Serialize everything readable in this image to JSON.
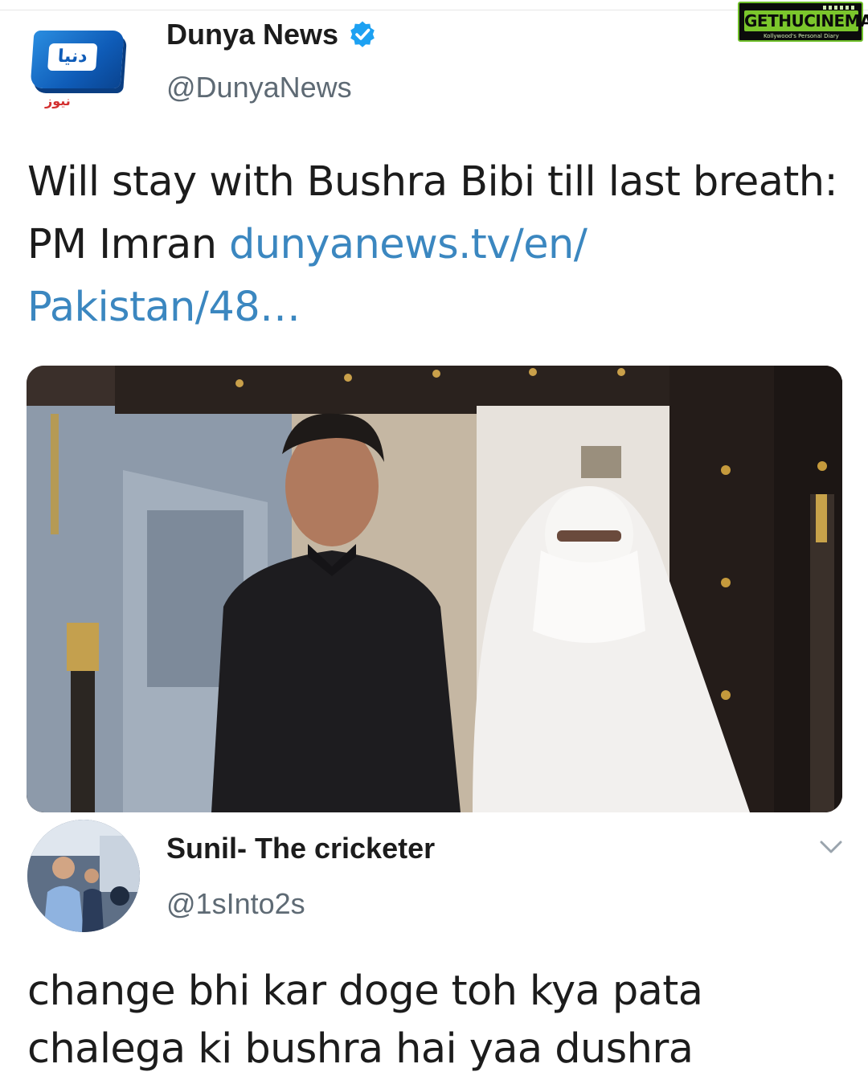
{
  "watermark": {
    "brand": "GETHUCINEMA",
    "tagline": "Kollywood's Personal Diary"
  },
  "tweet": {
    "author": {
      "name": "Dunya News",
      "handle": "@DunyaNews",
      "verified": true,
      "logo_text": "دنیا",
      "logo_sub": "نیوز"
    },
    "text": "Will stay with Bushra Bibi till last breath: PM Imran ",
    "link": "dunyanews.tv/en/ Pakistan/48…",
    "photo": {
      "icon": "photo-image"
    }
  },
  "reply": {
    "author": {
      "name": "Sunil- The cricketer",
      "handle": "@1sInto2s"
    },
    "text": "change bhi kar doge toh kya pata chalega ki bushra hai yaa dushra",
    "menu_icon": "chevron-down-icon"
  },
  "colors": {
    "link": "#3b87c0",
    "handle": "#5e6a74",
    "verified": "#1da1f2",
    "watermark_accent": "#7bc62c"
  }
}
